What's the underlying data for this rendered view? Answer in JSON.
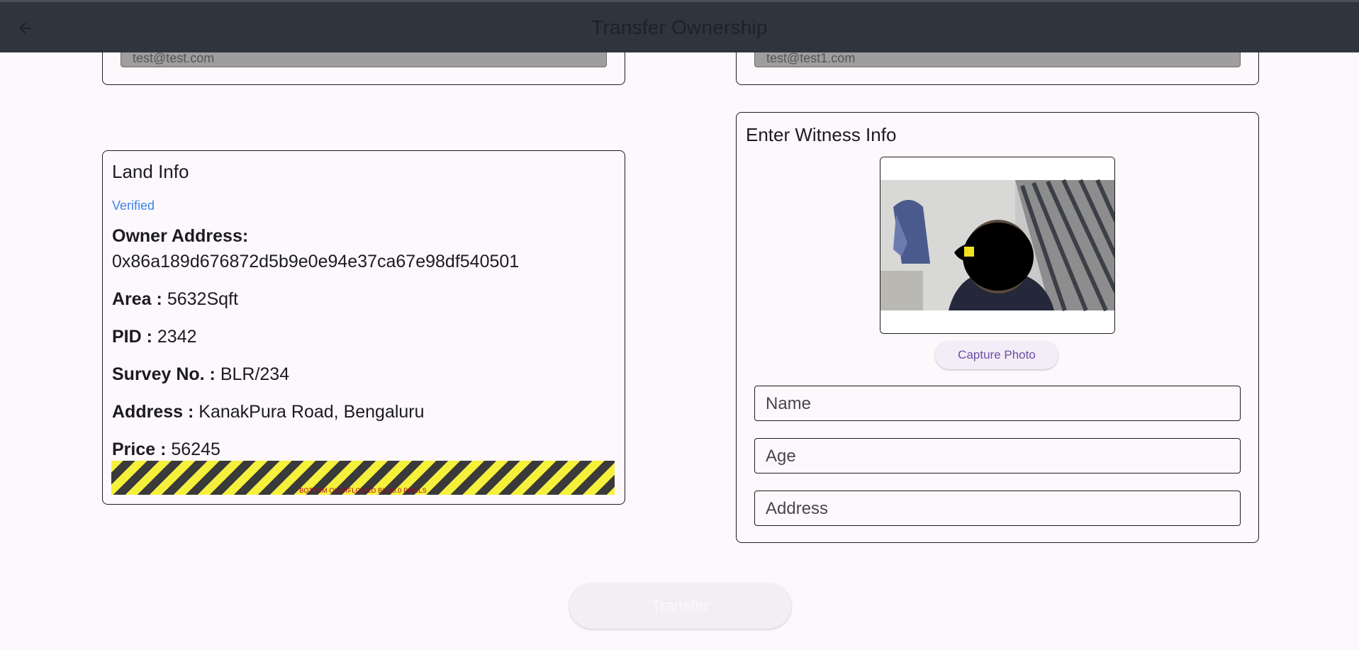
{
  "appbar": {
    "title": "Transfer Ownership",
    "back_icon": "arrow-left-icon"
  },
  "owner_card": {
    "email": "test@test.com"
  },
  "buyer_card": {
    "email": "test@test1.com"
  },
  "land_info": {
    "title": "Land Info",
    "status": "Verified",
    "owner_address_label": "Owner Address:",
    "owner_address_value": "0x86a189d676872d5b9e0e94e37ca67e98df540501",
    "area_label": "Area :",
    "area_value": "5632Sqft",
    "pid_label": "PID :",
    "pid_value": "2342",
    "survey_label": "Survey No. :",
    "survey_value": "BLR/234",
    "address_label": "Address :",
    "address_value": "KanakPura Road, Bengaluru",
    "price_label": "Price :",
    "price_value": "56245",
    "overflow_warning": "BOTTOM OVERFLOWED BY 10.0 PIXELS"
  },
  "witness": {
    "title": "Enter Witness Info",
    "capture_label": "Capture Photo",
    "name_placeholder": "Name",
    "age_placeholder": "Age",
    "address_placeholder": "Address"
  },
  "footer": {
    "transfer_label": "Transfer"
  },
  "colors": {
    "appbar": "#2f343f",
    "background": "#fdf8fc",
    "verified": "#3d85e6",
    "capture_text": "#6750a4"
  }
}
